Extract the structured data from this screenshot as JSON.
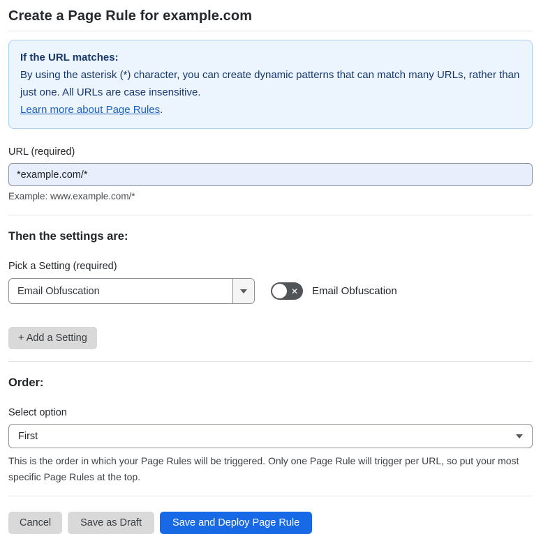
{
  "page": {
    "title": "Create a Page Rule for example.com"
  },
  "info_box": {
    "heading": "If the URL matches:",
    "body": "By using the asterisk (*) character, you can create dynamic patterns that can match many URLs, rather than just one. All URLs are case insensitive.",
    "link_label": "Learn more about Page Rules",
    "link_suffix": "."
  },
  "url_field": {
    "label": "URL (required)",
    "value": "*example.com/*",
    "helper": "Example: www.example.com/*"
  },
  "settings_section": {
    "heading": "Then the settings are:",
    "picker_label": "Pick a Setting (required)",
    "picker_value": "Email Obfuscation",
    "toggle_label": "Email Obfuscation",
    "toggle_state": "off",
    "toggle_glyph": "✕",
    "add_setting_label": "+ Add a Setting"
  },
  "order_section": {
    "heading": "Order:",
    "select_label": "Select option",
    "select_value": "First",
    "helper": "This is the order in which your Page Rules will be triggered. Only one Page Rule will trigger per URL, so put your most specific Page Rules at the top."
  },
  "footer": {
    "cancel_label": "Cancel",
    "save_draft_label": "Save as Draft",
    "deploy_label": "Save and Deploy Page Rule"
  },
  "colors": {
    "primary_blue": "#1869e6",
    "info_box_bg": "#ecf5fd",
    "info_box_border": "#a9cfee",
    "info_text": "#16376e",
    "link_blue": "#1a60c2",
    "url_input_bg": "#e8eefb",
    "toggle_track": "#515558",
    "gray_button": "#d9d9d9"
  }
}
